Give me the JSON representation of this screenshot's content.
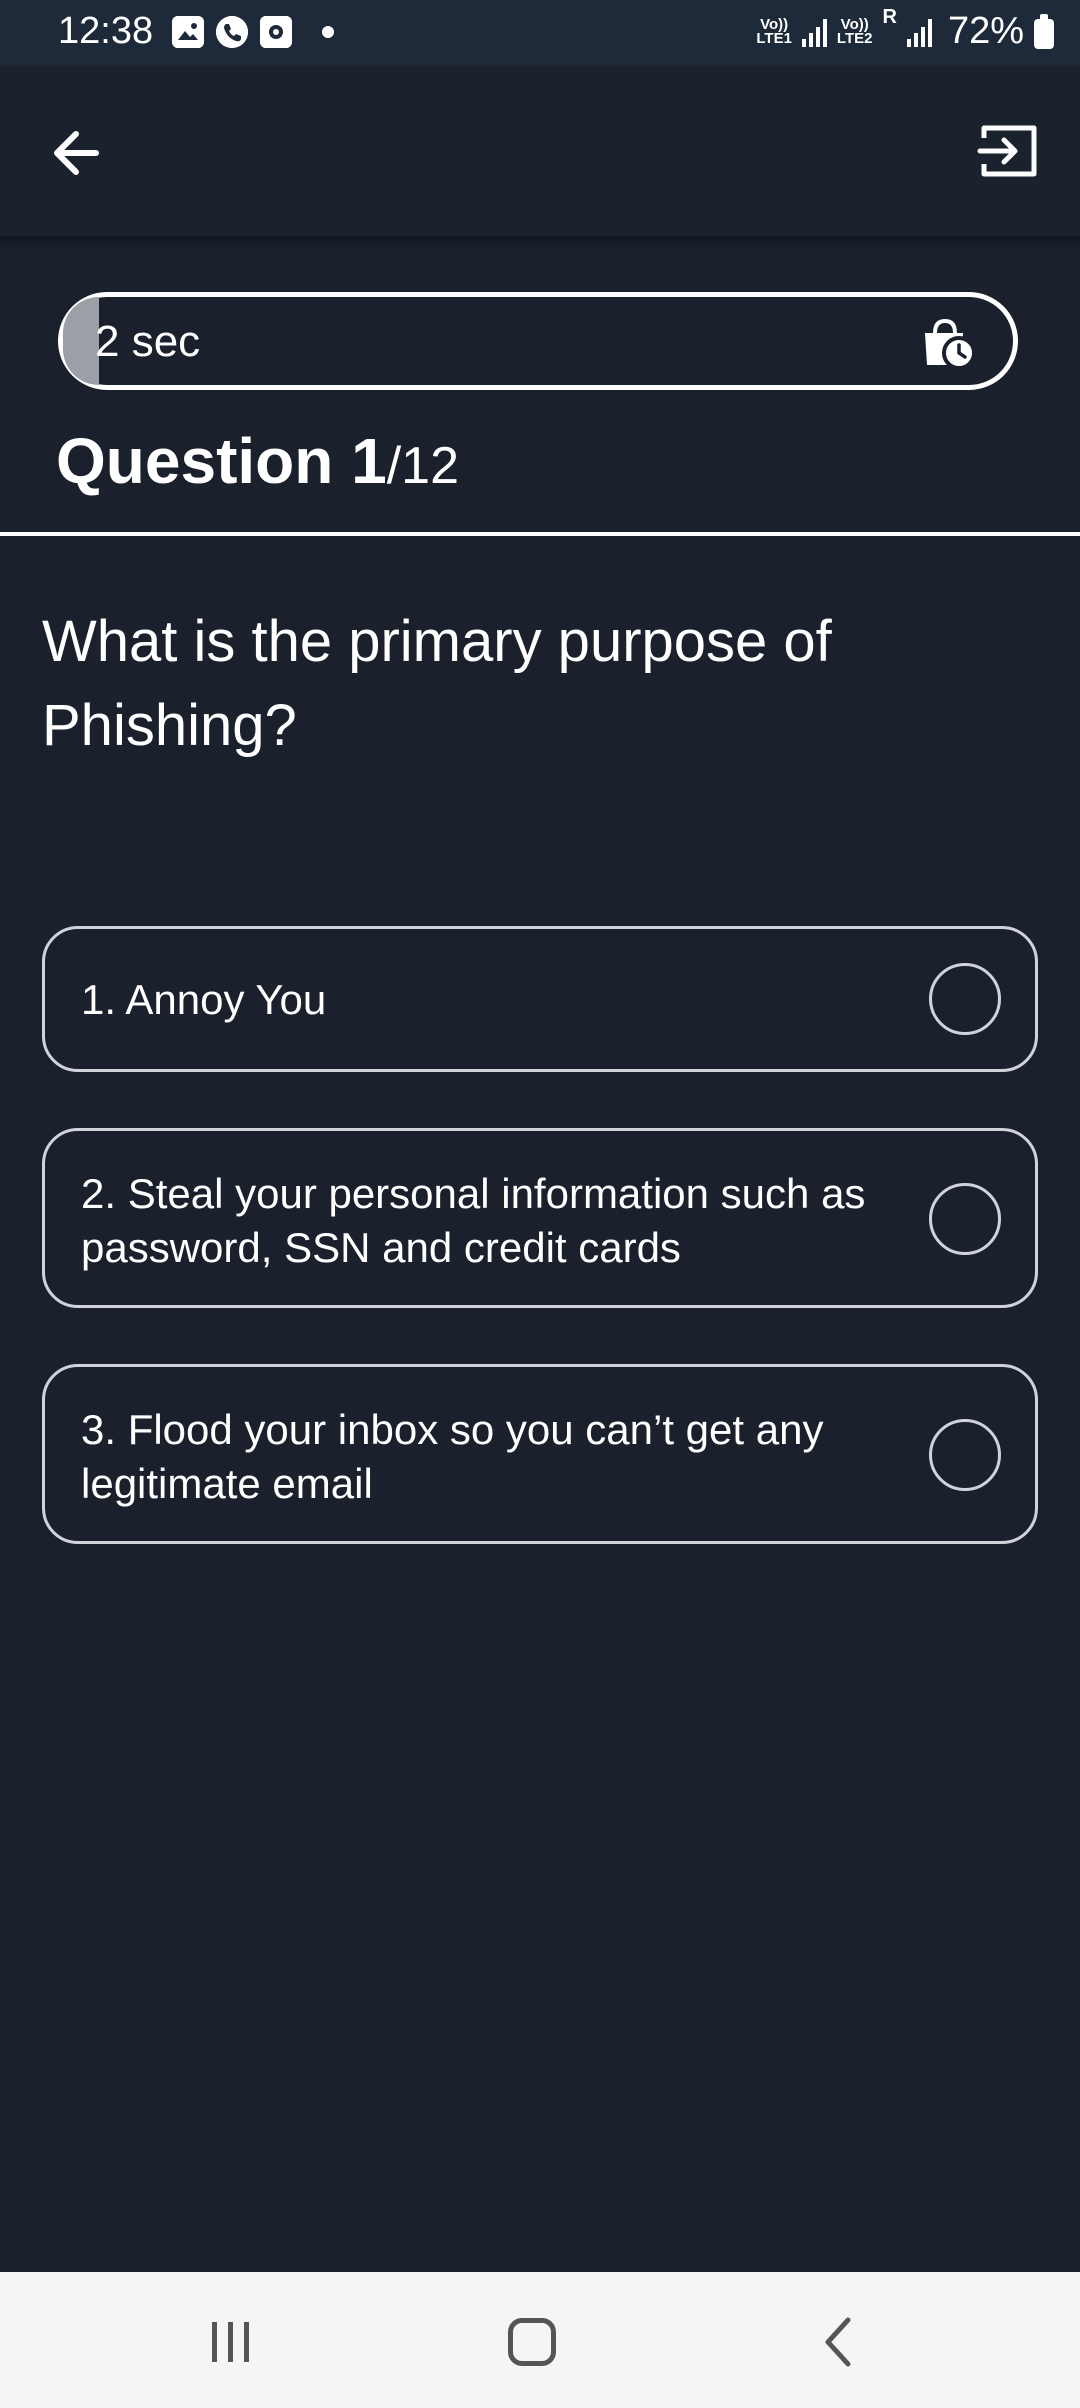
{
  "status_bar": {
    "time": "12:38",
    "sim1_label_top": "Vo))",
    "sim1_label_bottom": "LTE1",
    "sim2_label_top": "Vo))",
    "sim2_label_bottom": "LTE2",
    "roaming": "R",
    "battery": "72%",
    "icons": [
      "gallery-icon",
      "phone-icon",
      "screen-record-icon",
      "notification-dot"
    ]
  },
  "header": {
    "back_icon": "arrow-left-icon",
    "exit_icon": "exit-icon"
  },
  "timer": {
    "text": "2 sec",
    "progress_fraction": 0.03,
    "icon": "timer-bag-icon"
  },
  "question_header": {
    "label": "Question 1",
    "total": "/12"
  },
  "question": {
    "text": "What is the primary purpose of Phishing?"
  },
  "options": [
    {
      "label": "1. Annoy You",
      "selected": false
    },
    {
      "label": "2. Steal your personal information such as password, SSN and credit cards",
      "selected": false
    },
    {
      "label": "3. Flood your inbox so you can’t get any legitimate email",
      "selected": false
    }
  ],
  "nav": {
    "recent_icon": "recent-apps-icon",
    "home_icon": "home-icon",
    "back_icon": "back-chevron-icon"
  },
  "colors": {
    "background": "#1a212d",
    "status_bar": "#1e2a3a",
    "border": "#d0d4da",
    "nav_bar": "#f5f5f5"
  }
}
